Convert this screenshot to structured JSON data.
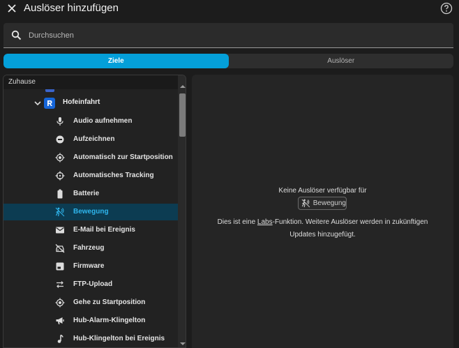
{
  "header": {
    "title": "Auslöser hinzufügen",
    "close_icon": "close-icon",
    "help_icon": "help-circle-icon"
  },
  "search": {
    "placeholder": "Durchsuchen",
    "value": ""
  },
  "tabs": [
    {
      "label": "Ziele",
      "active": true
    },
    {
      "label": "Auslöser",
      "active": false
    }
  ],
  "tree": {
    "header": "Zuhause",
    "group": {
      "label": "Hofeinfahrt",
      "icon": "camera-device-icon",
      "expanded": true
    },
    "items": [
      {
        "label": "Audio aufnehmen",
        "icon": "microphone-icon"
      },
      {
        "label": "Aufzeichnen",
        "icon": "record-icon"
      },
      {
        "label": "Automatisch zur Startposition",
        "icon": "target-icon"
      },
      {
        "label": "Automatisches Tracking",
        "icon": "crosshair-icon"
      },
      {
        "label": "Batterie",
        "icon": "battery-icon"
      },
      {
        "label": "Bewegung",
        "icon": "motion-icon",
        "selected": true
      },
      {
        "label": "E-Mail bei Ereignis",
        "icon": "mail-icon"
      },
      {
        "label": "Fahrzeug",
        "icon": "car-off-icon"
      },
      {
        "label": "Firmware",
        "icon": "firmware-icon"
      },
      {
        "label": "FTP-Upload",
        "icon": "swap-arrows-icon"
      },
      {
        "label": "Gehe zu Startposition",
        "icon": "target-icon"
      },
      {
        "label": "Hub-Alarm-Klingelton",
        "icon": "megaphone-icon"
      },
      {
        "label": "Hub-Klingelton bei Ereignis",
        "icon": "music-note-icon"
      }
    ]
  },
  "detail": {
    "empty_title": "Keine Auslöser verfügbar für",
    "chip_label": "Bewegung",
    "desc_before": "Dies ist eine ",
    "desc_link": "Labs",
    "desc_after": "-Funktion. Weitere Auslöser werden in zukünftigen Updates hinzugefügt."
  },
  "colors": {
    "accent": "#049fd9",
    "selected_bg": "#0c3c52",
    "selected_text": "#2fb5ec",
    "device_badge": "#1565d8"
  }
}
